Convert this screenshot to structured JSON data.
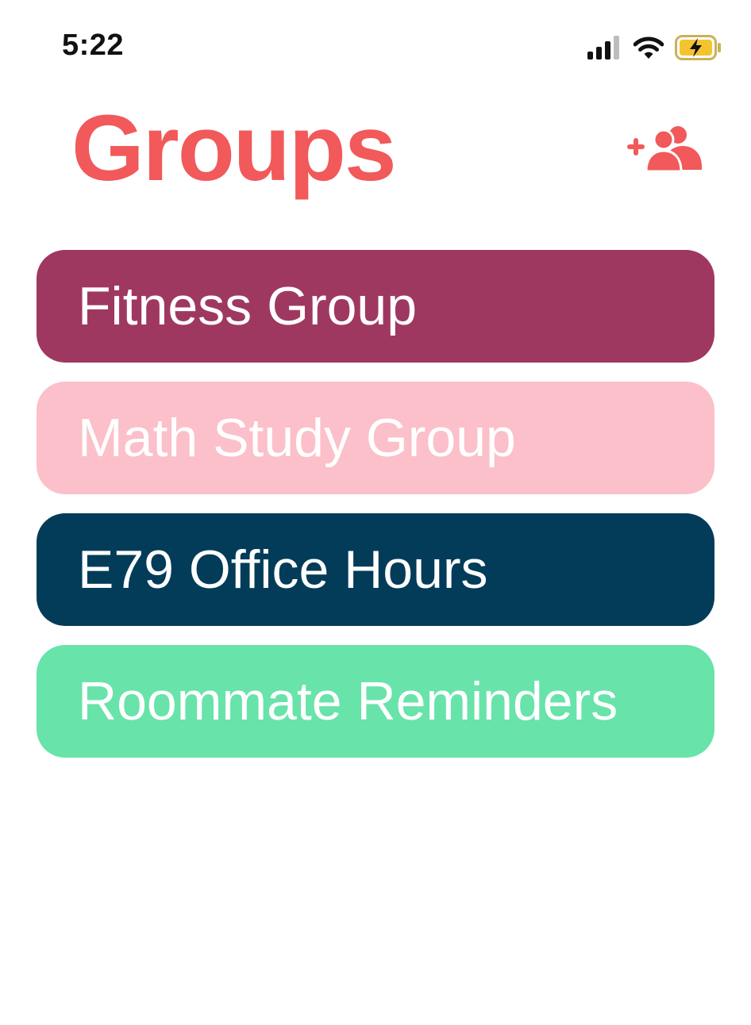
{
  "status_bar": {
    "time": "5:22",
    "icons": [
      "signal-icon",
      "wifi-icon",
      "battery-charging-icon"
    ],
    "battery_color": "#f4c430"
  },
  "header": {
    "title": "Groups",
    "title_color": "#f1595a",
    "add_button_icon": "add-group-icon"
  },
  "groups": [
    {
      "label": "Fitness Group",
      "color": "#9f3860"
    },
    {
      "label": "Math Study Group",
      "color": "#fbc0c9"
    },
    {
      "label": "E79 Office Hours",
      "color": "#033c59"
    },
    {
      "label": "Roommate Reminders",
      "color": "#68e3aa"
    }
  ]
}
